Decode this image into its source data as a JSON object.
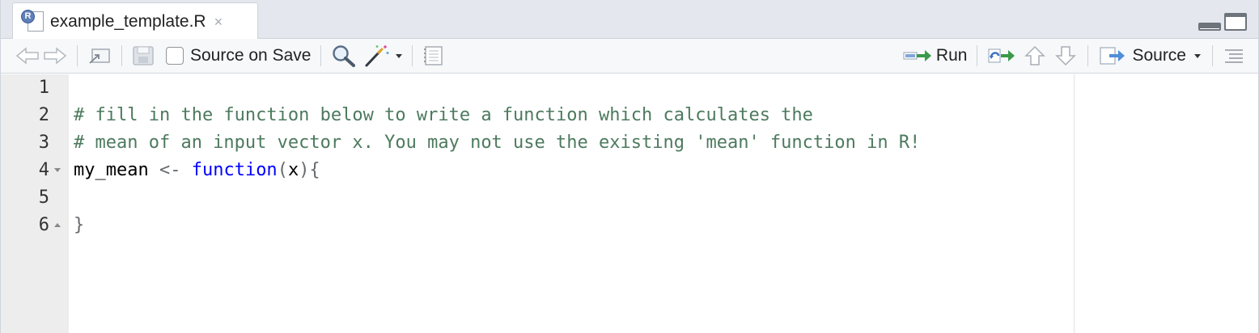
{
  "tab": {
    "title": "example_template.R",
    "close_glyph": "×",
    "badge_letter": "R",
    "icon": "r-script-file-icon"
  },
  "toolbar": {
    "source_on_save_label": "Source on Save",
    "source_on_save_checked": false,
    "run_label": "Run",
    "source_label": "Source"
  },
  "editor": {
    "line_numbers": [
      "1",
      "2",
      "3",
      "4",
      "5",
      "6"
    ],
    "lines": [
      [],
      [
        {
          "t": "# fill in the function below to write a function which calculates the",
          "c": "comment"
        }
      ],
      [
        {
          "t": "# mean of an input vector x. You may not use the existing 'mean' function in R!",
          "c": "comment"
        }
      ],
      [
        {
          "t": "my_mean ",
          "c": "plain"
        },
        {
          "t": "<-",
          "c": "op"
        },
        {
          "t": " ",
          "c": "plain"
        },
        {
          "t": "function",
          "c": "keyword"
        },
        {
          "t": "(",
          "c": "paren"
        },
        {
          "t": "x",
          "c": "plain"
        },
        {
          "t": "){",
          "c": "paren"
        }
      ],
      [],
      [
        {
          "t": "}",
          "c": "paren"
        }
      ]
    ],
    "fold_markers": {
      "4": "fold-open",
      "6": "fold-close"
    }
  },
  "colors": {
    "comment": "#4d7a5e",
    "keyword": "#0000ff",
    "gutter_bg": "#ededed",
    "toolbar_bg": "#f7f8fa",
    "tabbar_bg": "#e4e8ee",
    "run_arrow": "#3a9a4a"
  }
}
